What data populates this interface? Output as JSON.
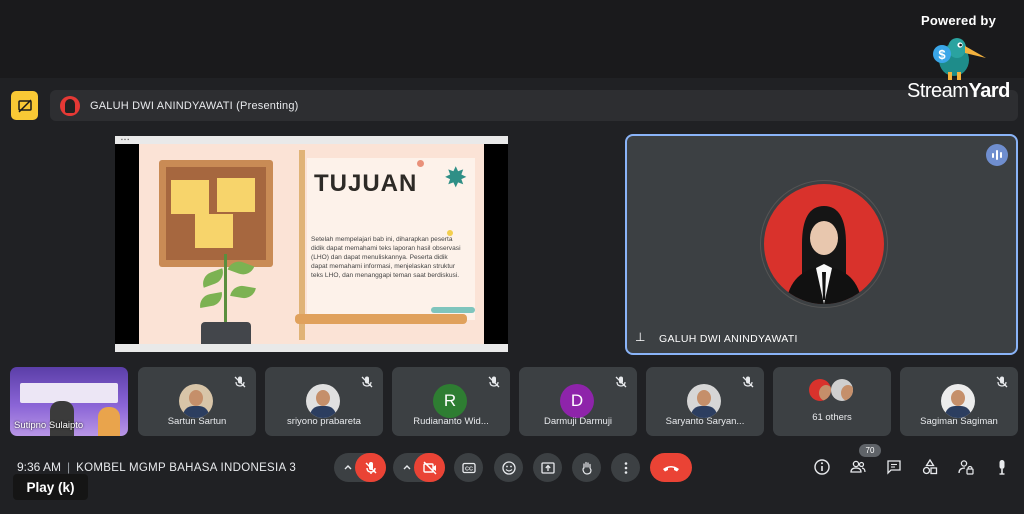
{
  "branding": {
    "powered_by": "Powered by",
    "logo_part1": "Stream",
    "logo_part2": "Yard"
  },
  "presenting": {
    "label": "GALUH DWI ANINDYAWATI (Presenting)"
  },
  "screen_share": {
    "slide_title": "TUJUAN",
    "slide_body": "Setelah mempelajari bab ini, diharapkan peserta didik dapat memahami teks laporan hasil observasi (LHO) dan dapat menuliskannya. Peserta didik dapat memahami informasi, menjelaskan struktur teks LHO, dan menanggapi teman saat berdiskusi."
  },
  "active_speaker": {
    "name": "GALUH DWI ANINDYAWATI"
  },
  "participants": [
    {
      "name": "Sutipno Sulaipto",
      "type": "video"
    },
    {
      "name": "Sartun Sartun",
      "type": "photo"
    },
    {
      "name": "sriyono prabareta",
      "type": "photo"
    },
    {
      "name": "Rudiananto Wid...",
      "type": "letter",
      "letter": "R",
      "color": "#2e7d32"
    },
    {
      "name": "Darmuji Darmuji",
      "type": "letter",
      "letter": "D",
      "color": "#8e24aa"
    },
    {
      "name": "Saryanto Saryan...",
      "type": "photo"
    },
    {
      "name": "61 others",
      "type": "group"
    },
    {
      "name": "Sagiman Sagiman",
      "type": "photo"
    }
  ],
  "bottom_bar": {
    "time": "9:36 AM",
    "meeting_name": "KOMBEL MGMP BAHASA INDONESIA 3",
    "play_tooltip": "Play (k)",
    "participant_count": "70"
  },
  "colors": {
    "accent_blue": "#8ab4f8",
    "danger_red": "#ea4335",
    "tile_bg": "#3c4043",
    "page_bg": "#202124",
    "present_icon_yellow": "#f9c935"
  },
  "icons": {
    "mic": "mic-off-icon",
    "camera": "camera-off-icon",
    "captions": "closed-captions-icon",
    "emoji": "emoji-icon",
    "present": "present-screen-icon",
    "hand": "raise-hand-icon",
    "more": "more-vert-icon",
    "end_call": "end-call-icon",
    "info": "info-icon",
    "people": "people-icon",
    "chat": "chat-icon",
    "activities": "activities-icon",
    "host_controls": "lock-person-icon",
    "mic_stand": "microphone-icon"
  }
}
